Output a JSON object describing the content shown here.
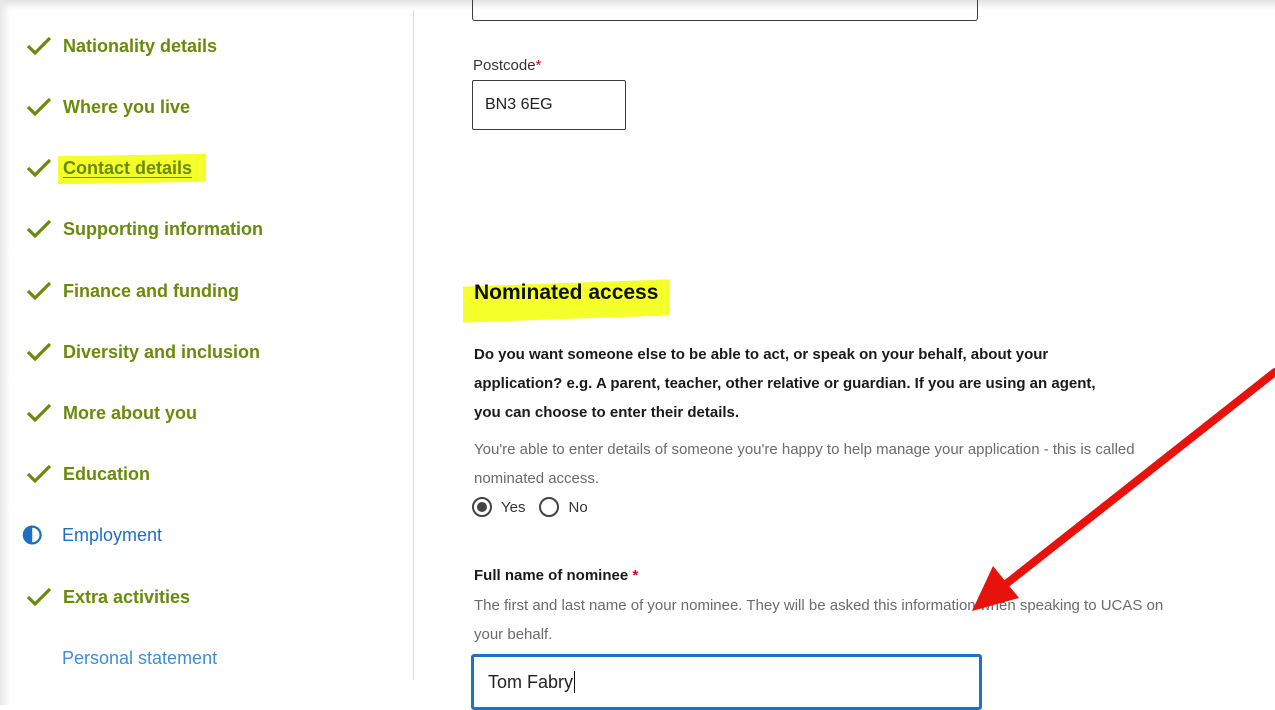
{
  "sidebar": {
    "items": [
      {
        "label": "Nationality details",
        "status": "complete"
      },
      {
        "label": "Where you live",
        "status": "complete"
      },
      {
        "label": "Contact details",
        "status": "complete",
        "highlighted": true
      },
      {
        "label": "Supporting information",
        "status": "complete"
      },
      {
        "label": "Finance and funding",
        "status": "complete"
      },
      {
        "label": "Diversity and inclusion",
        "status": "complete"
      },
      {
        "label": "More about you",
        "status": "complete"
      },
      {
        "label": "Education",
        "status": "complete"
      },
      {
        "label": "Employment",
        "status": "in-progress"
      },
      {
        "label": "Extra activities",
        "status": "complete"
      },
      {
        "label": "Personal statement",
        "status": "not-started"
      }
    ],
    "icons": {
      "complete": "checkmark-icon",
      "in_progress": "half-circle-icon"
    },
    "colors": {
      "complete": "#6a8a0a",
      "in_progress": "#1d6fc4",
      "not_started": "#3a8fd6"
    }
  },
  "address": {
    "postcode_label": "Postcode",
    "required_marker": "*",
    "postcode_value": "BN3 6EG"
  },
  "nominated": {
    "heading": "Nominated access",
    "question": "Do you want someone else to be able to act, or speak on your behalf, about your application? e.g. A parent, teacher, other relative or guardian. If you are using an agent, you can choose to enter their details.",
    "help": "You're able to enter details of someone you're happy to help manage your application - this is called nominated access.",
    "options": [
      {
        "label": "Yes",
        "selected": true
      },
      {
        "label": "No",
        "selected": false
      }
    ],
    "name_label": "Full name of nominee",
    "name_required_marker": "*",
    "name_help": "The first and last name of your nominee. They will be asked this information when speaking to UCAS on your behalf.",
    "name_value": "Tom Fabry"
  },
  "annotations": {
    "highlight_color": "#f5ff2a",
    "arrow_color": "#e8120c"
  }
}
